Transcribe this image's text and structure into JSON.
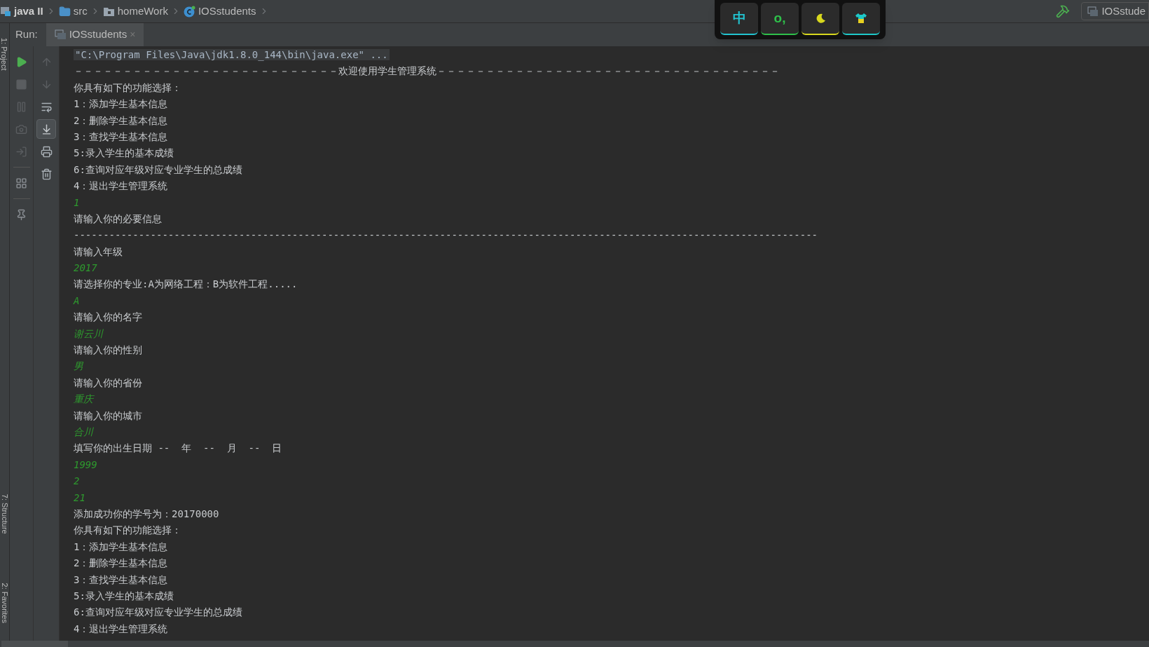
{
  "breadcrumbs": [
    {
      "label": "java II",
      "kind": "module"
    },
    {
      "label": "src",
      "kind": "folder"
    },
    {
      "label": "homeWork",
      "kind": "package"
    },
    {
      "label": "IOSstudents",
      "kind": "class"
    }
  ],
  "run_config": {
    "label": "IOSstude"
  },
  "ime_toolbar": {
    "keys": [
      {
        "kind": "text",
        "label": "中",
        "color": "#22c3d0"
      },
      {
        "kind": "text",
        "label": "o,",
        "color": "#2ec04a"
      },
      {
        "kind": "moon",
        "color": "#d8d81e"
      },
      {
        "kind": "shirt",
        "color": "#1ec8c8"
      }
    ]
  },
  "side_tabs": [
    "1: Project",
    "7: Structure",
    "2: Favorites"
  ],
  "run_panel": {
    "label": "Run:",
    "tabs": [
      {
        "label": "IOSstudents",
        "close": "×",
        "selected": true
      }
    ],
    "scroll_to_end": true
  },
  "console": {
    "lines": [
      {
        "kind": "command",
        "text": "\"C:\\Program Files\\Java\\jdk1.8.0_144\\bin\\java.exe\" ..."
      },
      {
        "kind": "output",
        "text": "－－－－－－－－－－－－－－－－－－－－－－－－－－－欢迎使用学生管理系统－－－－－－－－－－－－－－－－－－－－－－－－－－－－－－－－－－－"
      },
      {
        "kind": "output",
        "text": "你具有如下的功能选择："
      },
      {
        "kind": "output",
        "text": "1：添加学生基本信息"
      },
      {
        "kind": "output",
        "text": "2：删除学生基本信息"
      },
      {
        "kind": "output",
        "text": "3：查找学生基本信息"
      },
      {
        "kind": "output",
        "text": "5:录入学生的基本成绩"
      },
      {
        "kind": "output",
        "text": "6:查询对应年级对应专业学生的总成绩"
      },
      {
        "kind": "output",
        "text": "4：退出学生管理系统"
      },
      {
        "kind": "input",
        "text": "1"
      },
      {
        "kind": "output",
        "text": "请输入你的必要信息"
      },
      {
        "kind": "output",
        "text": "------------------------------------------------------------------------------------------------------------------------------"
      },
      {
        "kind": "output",
        "text": "请输入年级"
      },
      {
        "kind": "input",
        "text": "2017"
      },
      {
        "kind": "output",
        "text": "请选择你的专业:A为网络工程：B为软件工程....."
      },
      {
        "kind": "input",
        "text": "A"
      },
      {
        "kind": "output",
        "text": "请输入你的名字"
      },
      {
        "kind": "input",
        "text": "谢云川"
      },
      {
        "kind": "output",
        "text": "请输入你的性别"
      },
      {
        "kind": "input",
        "text": "男"
      },
      {
        "kind": "output",
        "text": "请输入你的省份"
      },
      {
        "kind": "input",
        "text": "重庆"
      },
      {
        "kind": "output",
        "text": "请输入你的城市"
      },
      {
        "kind": "input",
        "text": "合川"
      },
      {
        "kind": "output",
        "text": "填写你的出生日期 --  年  --  月  --  日"
      },
      {
        "kind": "input",
        "text": "1999"
      },
      {
        "kind": "input",
        "text": "2"
      },
      {
        "kind": "input",
        "text": "21"
      },
      {
        "kind": "output",
        "text": "添加成功你的学号为：20170000"
      },
      {
        "kind": "output",
        "text": "你具有如下的功能选择："
      },
      {
        "kind": "output",
        "text": "1：添加学生基本信息"
      },
      {
        "kind": "output",
        "text": "2：删除学生基本信息"
      },
      {
        "kind": "output",
        "text": "3：查找学生基本信息"
      },
      {
        "kind": "output",
        "text": "5:录入学生的基本成绩"
      },
      {
        "kind": "output",
        "text": "6:查询对应年级对应专业学生的总成绩"
      },
      {
        "kind": "output",
        "text": "4：退出学生管理系统"
      }
    ]
  }
}
